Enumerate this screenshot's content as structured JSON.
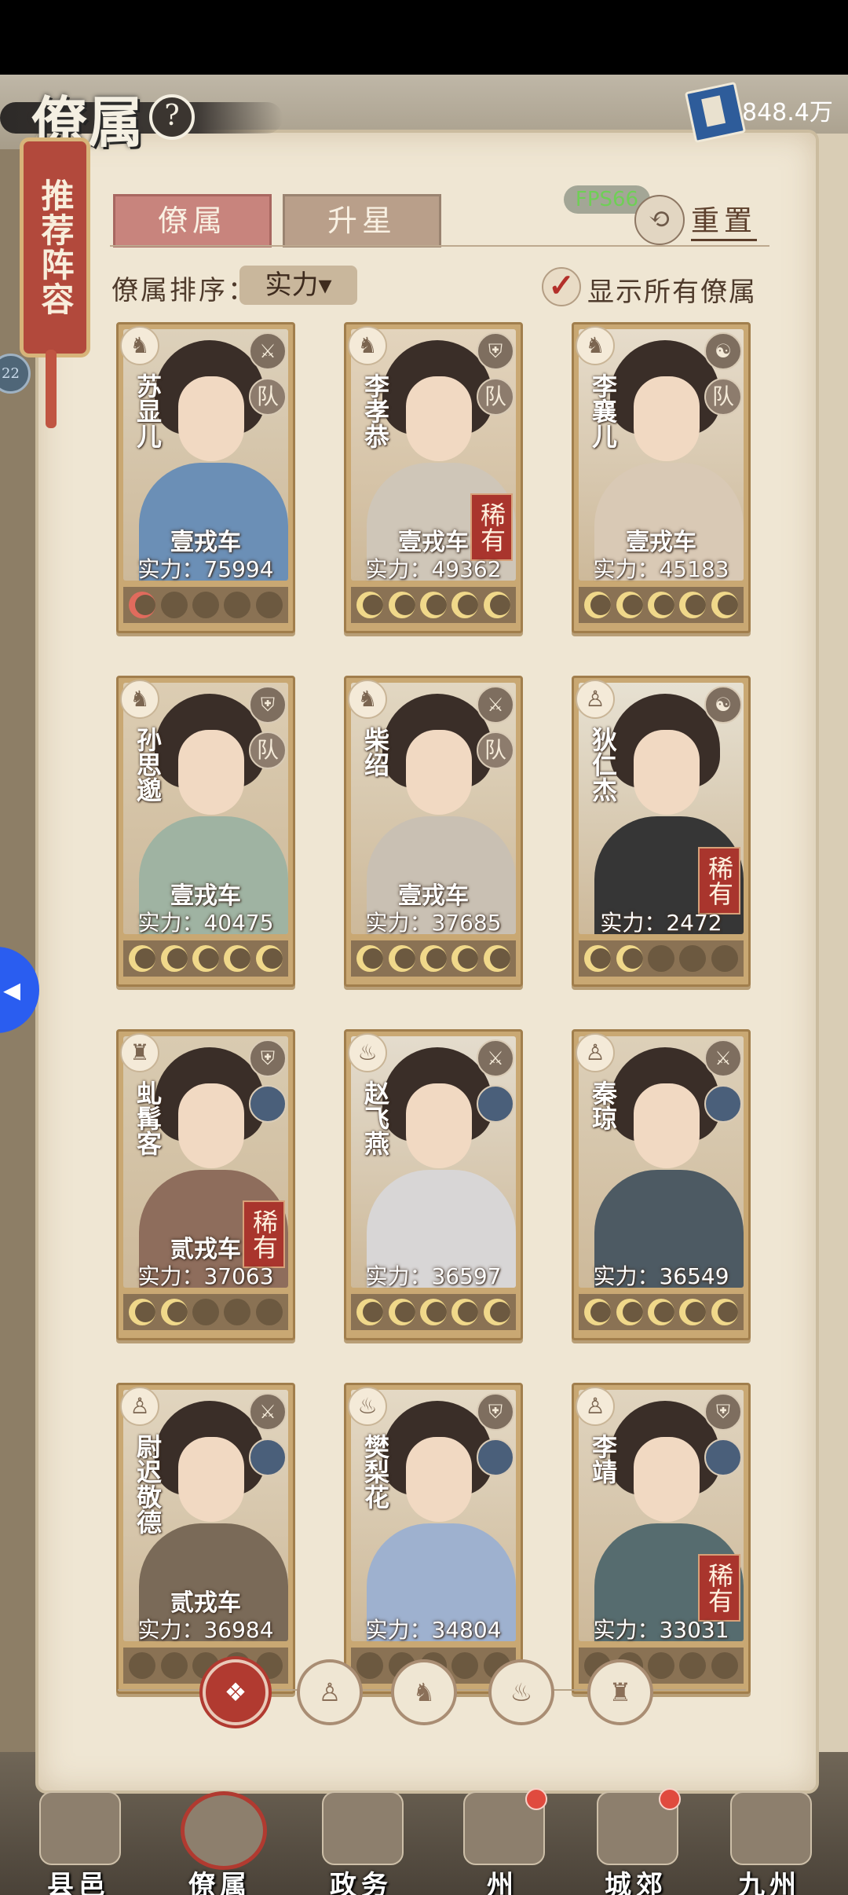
{
  "header": {
    "title": "僚属",
    "help_icon": "question-icon",
    "currency": "848.4万",
    "currency_icon": "book-icon"
  },
  "banner": {
    "label": "推荐阵容"
  },
  "side": {
    "bubble": "22"
  },
  "tabs": [
    {
      "label": "僚属"
    },
    {
      "label": "升星"
    }
  ],
  "fps": "FPS66",
  "reset": {
    "label": "重置"
  },
  "sort": {
    "label": "僚属排序：",
    "value": "实力▾"
  },
  "show_all": {
    "label": "显示所有僚属",
    "checked": true
  },
  "cards": [
    {
      "name": "苏显儿",
      "rank": "壹戎车",
      "power": "实力：75994",
      "rare": "",
      "team": "队",
      "stars_on": 1,
      "star_color": "red"
    },
    {
      "name": "李孝恭",
      "rank": "壹戎车",
      "power": "实力：49362",
      "rare": "稀有",
      "team": "队",
      "stars_on": 5,
      "star_color": "gold"
    },
    {
      "name": "李襄儿",
      "rank": "壹戎车",
      "power": "实力：45183",
      "rare": "",
      "team": "队",
      "stars_on": 5,
      "star_color": "gold"
    },
    {
      "name": "孙思邈",
      "rank": "壹戎车",
      "power": "实力：40475",
      "rare": "",
      "team": "队",
      "stars_on": 5,
      "star_color": "gold"
    },
    {
      "name": "柴绍",
      "rank": "壹戎车",
      "power": "实力：37685",
      "rare": "",
      "team": "队",
      "stars_on": 5,
      "star_color": "gold"
    },
    {
      "name": "狄仁杰",
      "rank": "",
      "power": "实力：2472",
      "rare": "稀有",
      "team": "",
      "stars_on": 2,
      "star_color": "gold"
    },
    {
      "name": "虬髯客",
      "rank": "贰戎车",
      "power": "实力：37063",
      "rare": "稀有",
      "team": "",
      "stars_on": 2,
      "star_color": "gold"
    },
    {
      "name": "赵飞燕",
      "rank": "",
      "power": "实力：36597",
      "rare": "",
      "team": "",
      "stars_on": 5,
      "star_color": "gold"
    },
    {
      "name": "秦琼",
      "rank": "",
      "power": "实力：36549",
      "rare": "",
      "team": "",
      "stars_on": 5,
      "star_color": "gold"
    },
    {
      "name": "尉迟敬德",
      "rank": "贰戎车",
      "power": "实力：36984",
      "rare": "",
      "team": "",
      "stars_on": 0,
      "star_color": "gold"
    },
    {
      "name": "樊梨花",
      "rank": "",
      "power": "实力：34804",
      "rare": "",
      "team": "",
      "stars_on": 0,
      "star_color": "gold"
    },
    {
      "name": "李靖",
      "rank": "",
      "power": "实力：33031",
      "rare": "稀有",
      "team": "",
      "stars_on": 0,
      "star_color": "gold"
    }
  ],
  "filters": [
    {
      "icon": "all-icon",
      "glyph": "❖",
      "active": true
    },
    {
      "icon": "general-icon",
      "glyph": "♙",
      "active": false
    },
    {
      "icon": "cat-icon",
      "glyph": "♞",
      "active": false
    },
    {
      "icon": "fan-icon",
      "glyph": "♨",
      "active": false
    },
    {
      "icon": "rat-icon",
      "glyph": "♜",
      "active": false
    }
  ],
  "nav": [
    {
      "label": "县邑",
      "dot": false,
      "selected": false
    },
    {
      "label": "僚属",
      "dot": false,
      "selected": true
    },
    {
      "label": "政务",
      "dot": false,
      "selected": false
    },
    {
      "label": "州",
      "dot": true,
      "selected": false
    },
    {
      "label": "城郊",
      "dot": true,
      "selected": false
    },
    {
      "label": "九州",
      "dot": false,
      "selected": false
    }
  ]
}
